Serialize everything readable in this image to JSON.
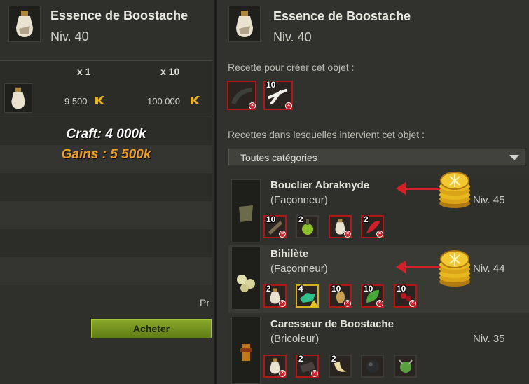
{
  "left": {
    "item_name": "Essence de Boostache",
    "item_level": "Niv. 40",
    "col_1": "x 1",
    "col_10": "x 10",
    "price_1": "9 500",
    "price_10": "100 000",
    "craft_line": "Craft: 4 000k",
    "gains_line": "Gains : 5 500k",
    "truncated_label": "Pr",
    "buy_label": "Acheter"
  },
  "right": {
    "item_name": "Essence de Boostache",
    "item_level": "Niv. 40",
    "recipe_label": "Recette pour créer cet objet :",
    "recipe_slots": [
      {
        "qty": "",
        "status": "missing"
      },
      {
        "qty": "10",
        "status": "missing"
      }
    ],
    "used_in_label": "Recettes dans lesquelles intervient cet objet :",
    "filter_value": "Toutes catégories",
    "recipes": [
      {
        "name": "Bouclier Abraknyde",
        "job": "(Façonneur)",
        "level": "Niv. 45",
        "ingredients": [
          {
            "qty": "10",
            "status": "missing"
          },
          {
            "qty": "2",
            "status": "ok"
          },
          {
            "qty": "",
            "status": "missing"
          },
          {
            "qty": "2",
            "status": "missing"
          }
        ]
      },
      {
        "name": "Bihilète",
        "job": "(Façonneur)",
        "level": "Niv. 44",
        "ingredients": [
          {
            "qty": "2",
            "status": "missing"
          },
          {
            "qty": "4",
            "status": "warning"
          },
          {
            "qty": "10",
            "status": "missing"
          },
          {
            "qty": "10",
            "status": "missing"
          },
          {
            "qty": "10",
            "status": "missing"
          }
        ]
      },
      {
        "name": "Caresseur de Boostache",
        "job": "(Bricoleur)",
        "level": "Niv. 35",
        "ingredients": [
          {
            "qty": "",
            "status": "missing"
          },
          {
            "qty": "2",
            "status": "missing"
          },
          {
            "qty": "2",
            "status": "ok"
          },
          {
            "qty": "",
            "status": "ok"
          },
          {
            "qty": "",
            "status": "ok"
          }
        ]
      }
    ]
  },
  "colors": {
    "craft": "#ffffff",
    "gains": "#f0a020",
    "missing_border": "#b01818",
    "warning_border": "#d4b21e",
    "kama_gold": "#e9b21a",
    "arrow": "#d3202a",
    "buy_button": "#7a9a20"
  },
  "icons": {
    "item": "potion-bottle-icon",
    "currency": "kama-icon",
    "annotation": "gold-coins-icon"
  }
}
